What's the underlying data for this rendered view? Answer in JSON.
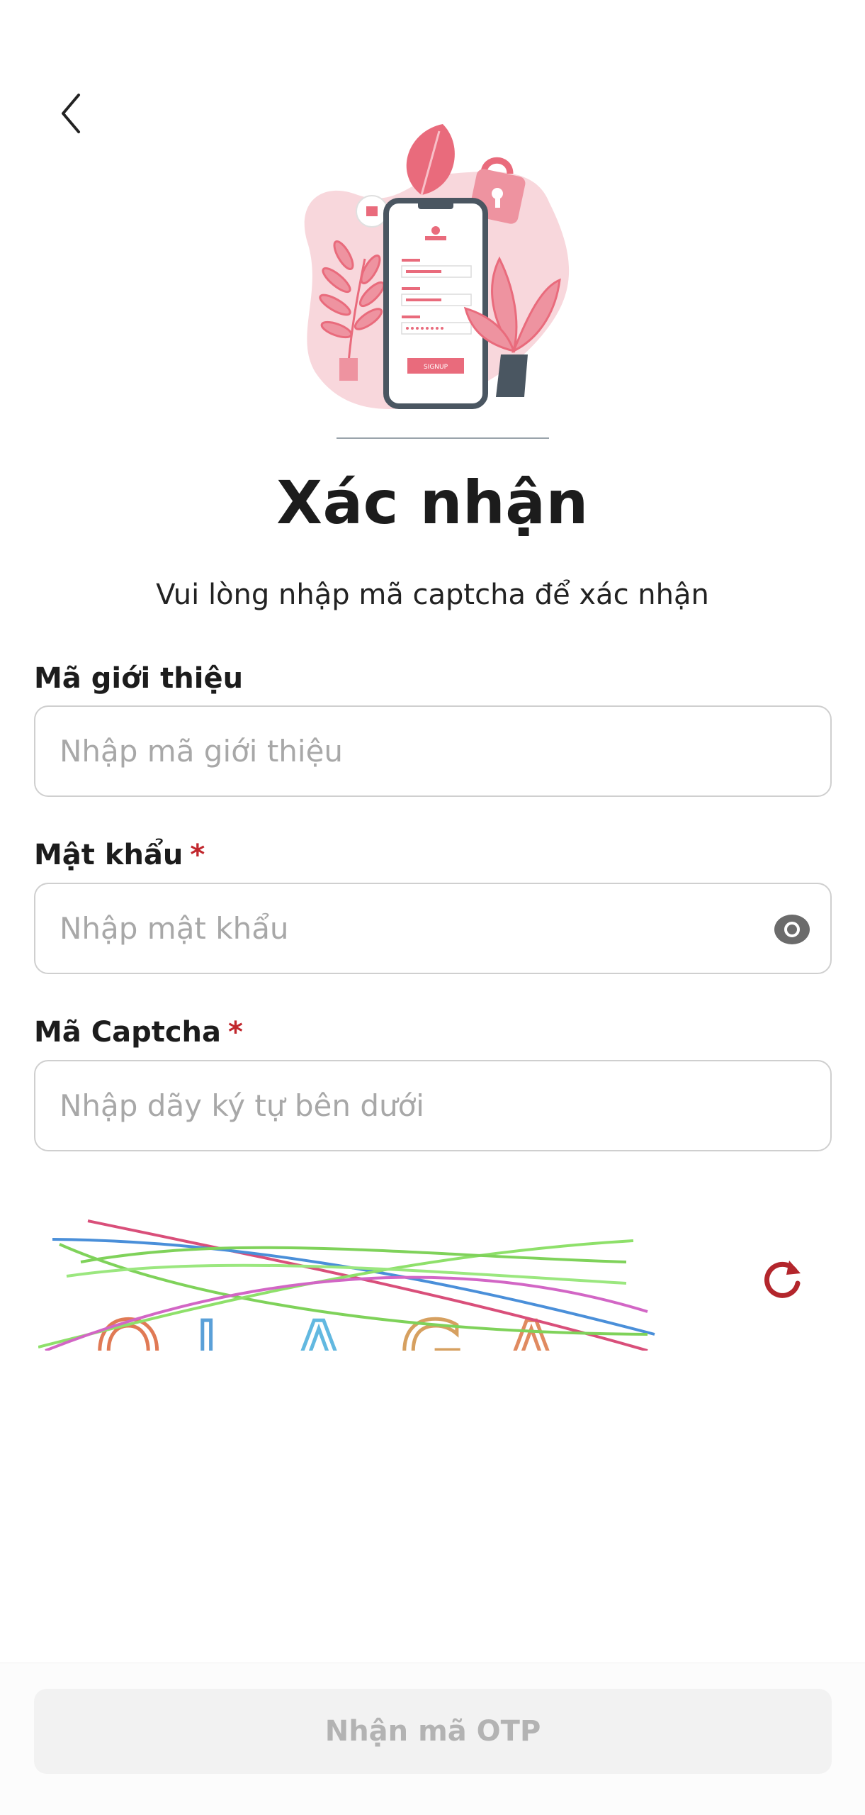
{
  "header": {
    "back_icon": "chevron-left-icon"
  },
  "illustration": {
    "name": "phone-signup-illustration",
    "button_text": "SIGNUP",
    "accent_color": "#e96b7c"
  },
  "title": "Xác nhận",
  "subtitle": "Vui lòng nhập mã captcha để xác nhận",
  "form": {
    "referral": {
      "label": "Mã giới thiệu",
      "placeholder": "Nhập mã giới thiệu",
      "value": ""
    },
    "password": {
      "label": "Mật khẩu",
      "required_mark": "*",
      "placeholder": "Nhập mật khẩu",
      "value": "",
      "toggle_icon": "eye-icon"
    },
    "captcha": {
      "label": "Mã Captcha",
      "required_mark": "*",
      "placeholder": "Nhập dãy ký tự bên dưới",
      "value": "",
      "image_text": "OIAGA",
      "refresh_icon": "refresh-icon"
    }
  },
  "submit_button": {
    "label": "Nhận mã OTP",
    "disabled": true
  },
  "colors": {
    "required": "#c1272d",
    "refresh": "#b3262c",
    "input_border": "#cfcfcf",
    "placeholder": "#a8a8a8",
    "button_disabled_bg": "#f2f2f2",
    "button_disabled_text": "#b3b3b3"
  }
}
